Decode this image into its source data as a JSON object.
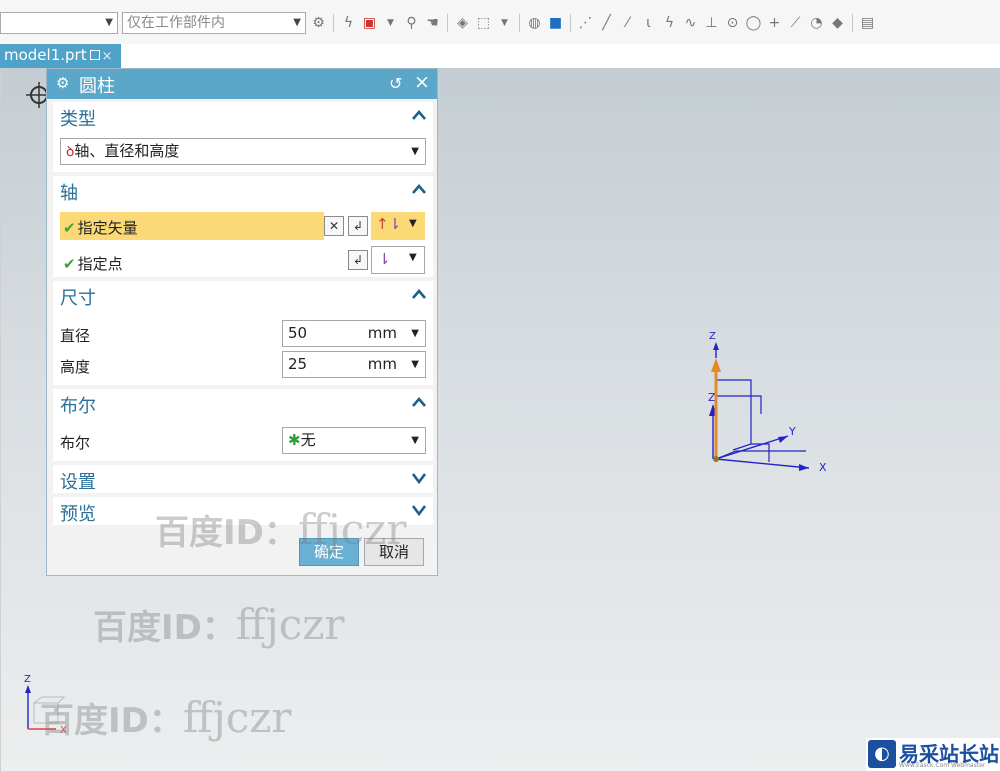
{
  "toolbar": {
    "filter_select_value": "",
    "scope_select_value": "仅在工作部件内"
  },
  "tab": {
    "label": "model1.prt",
    "close": "×"
  },
  "dialog": {
    "title": "圆柱",
    "reset_glyph": "↺",
    "close_glyph": "×",
    "sections": {
      "type": {
        "title": "类型",
        "value": "轴、直径和高度"
      },
      "axis": {
        "title": "轴",
        "specify_vector": "指定矢量",
        "specify_point": "指定点"
      },
      "dimensions": {
        "title": "尺寸",
        "diameter_label": "直径",
        "diameter_value": "50",
        "diameter_unit": "mm",
        "height_label": "高度",
        "height_value": "25",
        "height_unit": "mm"
      },
      "boolean": {
        "title": "布尔",
        "label": "布尔",
        "value": "无"
      },
      "settings": {
        "title": "设置"
      },
      "preview": {
        "title": "预览"
      }
    },
    "ok_label": "确定",
    "cancel_label": "取消"
  },
  "triad": {
    "z": "Z",
    "y": "Y",
    "x": "X"
  },
  "mini_triad": {
    "z": "Z",
    "x": "X"
  },
  "watermarks": {
    "bold": "百度ID：",
    "name": "ffjczr"
  },
  "logo": {
    "name": "易采站长站",
    "sub": "Www.Easck.Com Webmaster"
  },
  "colors": {
    "accent": "#5aa7c9",
    "section_title": "#2b6f9a",
    "highlight_row": "#fcd977",
    "axis_blue": "#2323c8",
    "axis_orange": "#e58a2a"
  }
}
